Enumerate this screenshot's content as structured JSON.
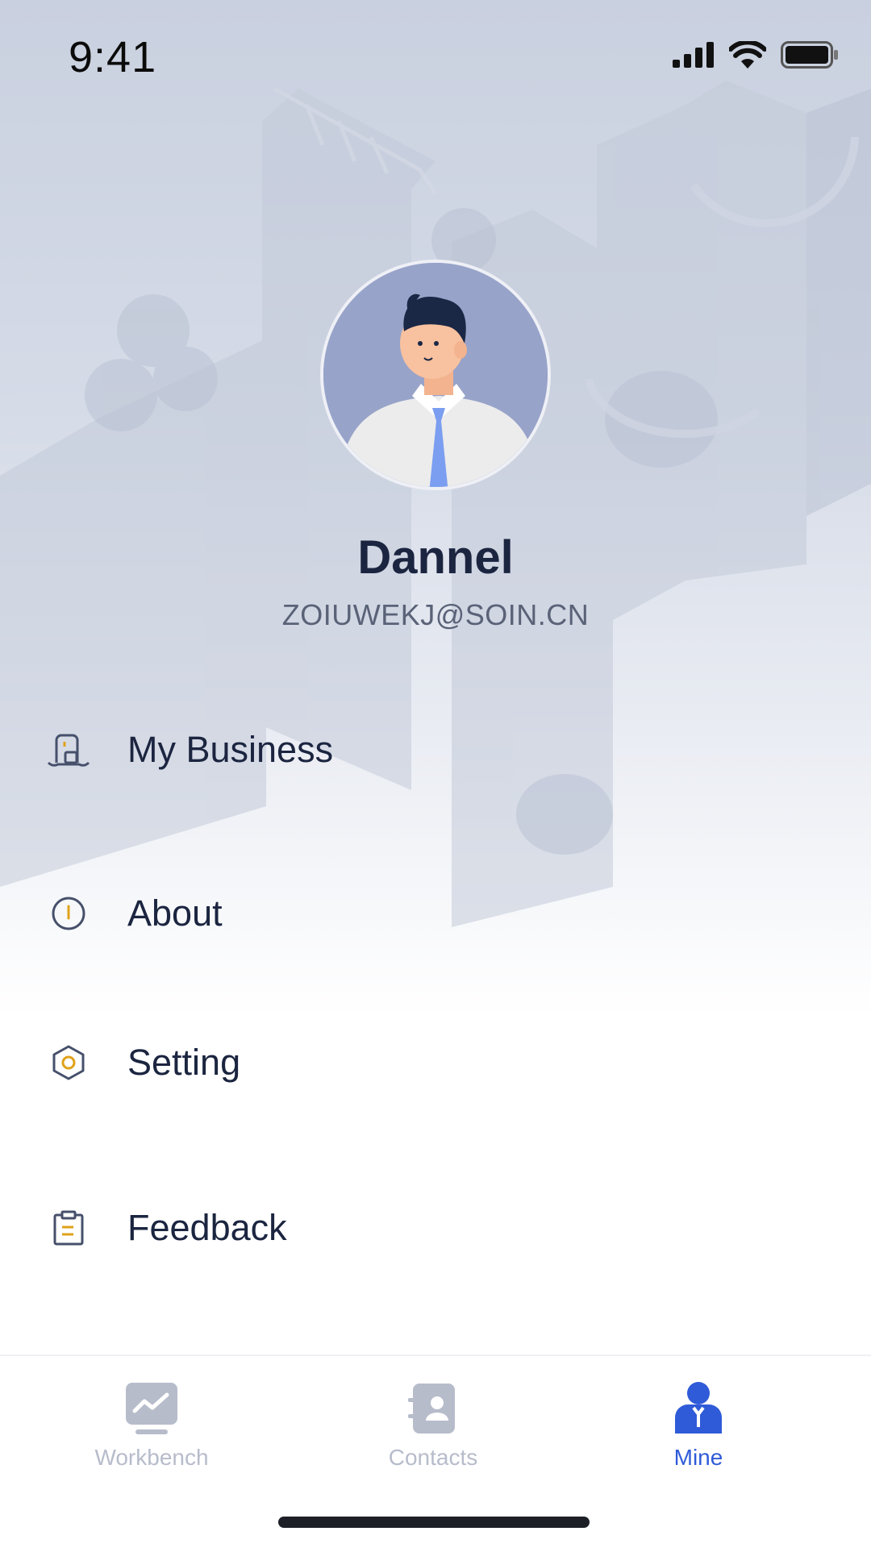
{
  "status_bar": {
    "time": "9:41"
  },
  "profile": {
    "name": "Dannel",
    "email": "ZOIUWEKJ@SOIN.CN"
  },
  "menu": {
    "items": [
      {
        "label": "My Business",
        "icon": "business-icon"
      },
      {
        "label": "About",
        "icon": "info-icon"
      },
      {
        "label": "Setting",
        "icon": "settings-icon"
      },
      {
        "label": "Feedback",
        "icon": "clipboard-icon"
      }
    ]
  },
  "tab_bar": {
    "tabs": [
      {
        "label": "Workbench",
        "icon": "workbench-icon",
        "active": false
      },
      {
        "label": "Contacts",
        "icon": "contacts-icon",
        "active": false
      },
      {
        "label": "Mine",
        "icon": "person-icon",
        "active": true
      }
    ]
  },
  "colors": {
    "accent": "#2f5bd8",
    "menu_icon_accent": "#e0a21a",
    "text_primary": "#1b2540",
    "tab_inactive": "#b7bccb"
  }
}
